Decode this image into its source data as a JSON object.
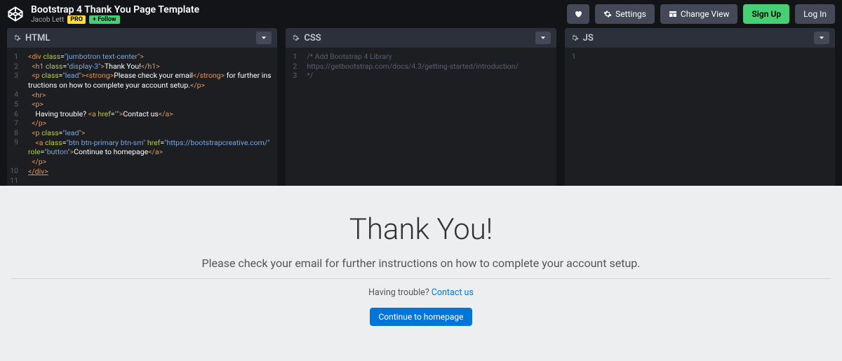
{
  "header": {
    "title": "Bootstrap 4 Thank You Page Template",
    "author": "Jacob Lett",
    "pro": "PRO",
    "follow": "+ Follow",
    "settings": "Settings",
    "changeView": "Change View",
    "signUp": "Sign Up",
    "logIn": "Log In"
  },
  "editors": {
    "html": {
      "title": "HTML"
    },
    "css": {
      "title": "CSS"
    },
    "js": {
      "title": "JS"
    }
  },
  "code": {
    "css1": "/* Add Bootstrap 4 Library",
    "css2": "https://getbootstrap.com/docs/4.3/getting-started/introduction/",
    "css3": "*/"
  },
  "preview": {
    "heading": "Thank You!",
    "lead": "Please check your email for further instructions on how to complete your account setup.",
    "trouble": "Having trouble? ",
    "contact": "Contact us",
    "continue": "Continue to homepage"
  }
}
